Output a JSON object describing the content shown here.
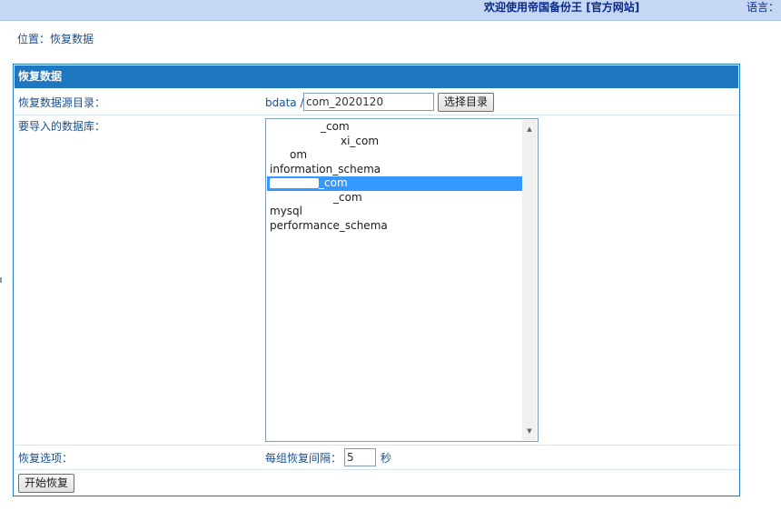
{
  "topbar": {
    "welcome_text": "欢迎使用帝国备份王",
    "site_link": "[官方网站]",
    "language_label": "语言："
  },
  "breadcrumb": "位置：恢复数据",
  "panel": {
    "title": "恢复数据",
    "source_dir": {
      "label": "恢复数据源目录：",
      "prefix": "bdata /",
      "value": "com_2020120",
      "button": "选择目录"
    },
    "databases": {
      "label": "要导入的数据库：",
      "options": [
        {
          "text": "_com",
          "selected": false
        },
        {
          "text": "xi_com",
          "selected": false
        },
        {
          "text": "om",
          "selected": false
        },
        {
          "text": "information_schema",
          "selected": false
        },
        {
          "text": "_com",
          "selected": true
        },
        {
          "text": "_com",
          "selected": false
        },
        {
          "text": "mysql",
          "selected": false
        },
        {
          "text": "performance_schema",
          "selected": false
        }
      ]
    },
    "options": {
      "label": "恢复选项：",
      "interval_label": "每组恢复间隔：",
      "interval_value": "5",
      "interval_unit": "秒"
    },
    "start_button": "开始恢复"
  },
  "colors": {
    "header_bg": "#1f77c0",
    "topbar_bg": "#c5d7f3",
    "selected_bg": "#3399ff",
    "text": "#1a4f8c"
  },
  "icons": {
    "scroll_up": "up-triangle",
    "scroll_down": "down-triangle"
  }
}
